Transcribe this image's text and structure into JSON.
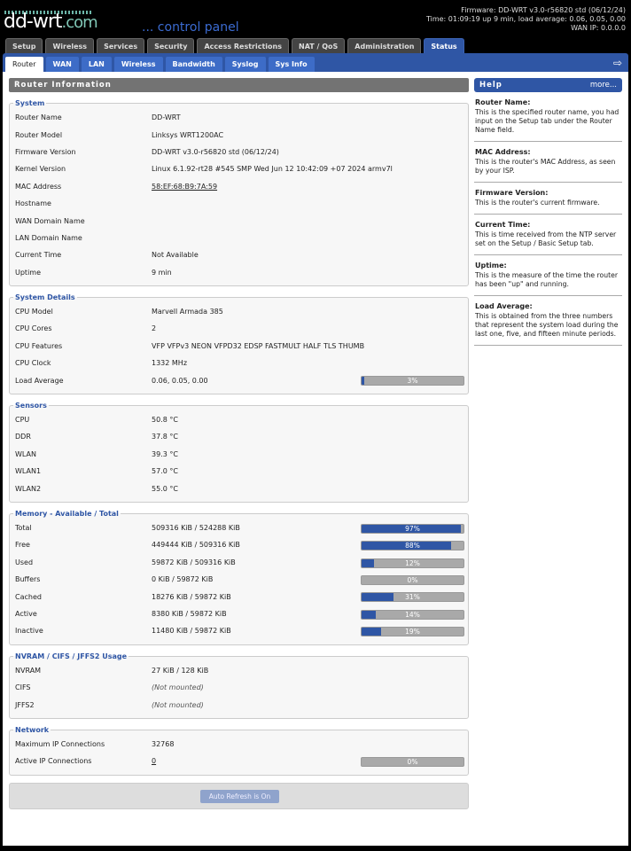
{
  "header": {
    "logo": "dd-wrt",
    "logo_com": ".com",
    "tagline": "... control panel",
    "firmware": "Firmware: DD-WRT v3.0-r56820 std (06/12/24)",
    "time": "Time: 01:09:19 up 9 min, load average: 0.06, 0.05, 0.00",
    "wan_ip": "WAN IP: 0.0.0.0"
  },
  "main_tabs": [
    "Setup",
    "Wireless",
    "Services",
    "Security",
    "Access Restrictions",
    "NAT / QoS",
    "Administration",
    "Status"
  ],
  "sub_tabs": [
    "Router",
    "WAN",
    "LAN",
    "Wireless",
    "Bandwidth",
    "Syslog",
    "Sys Info"
  ],
  "section_title": "Router Information",
  "system": {
    "legend": "System",
    "rows": [
      [
        "Router Name",
        "DD-WRT"
      ],
      [
        "Router Model",
        "Linksys WRT1200AC"
      ],
      [
        "Firmware Version",
        "DD-WRT v3.0-r56820 std (06/12/24)"
      ],
      [
        "Kernel Version",
        "Linux 6.1.92-rt28 #545 SMP Wed Jun 12 10:42:09 +07 2024 armv7l"
      ],
      [
        "MAC Address",
        "58:EF:68:B9:7A:59"
      ],
      [
        "Hostname",
        ""
      ],
      [
        "WAN Domain Name",
        ""
      ],
      [
        "LAN Domain Name",
        ""
      ],
      [
        "Current Time",
        "Not Available"
      ],
      [
        "Uptime",
        "9 min"
      ]
    ]
  },
  "details": {
    "legend": "System Details",
    "rows": [
      [
        "CPU Model",
        "Marvell Armada 385"
      ],
      [
        "CPU Cores",
        "2"
      ],
      [
        "CPU Features",
        "VFP VFPv3 NEON VFPD32 EDSP FASTMULT HALF TLS THUMB"
      ],
      [
        "CPU Clock",
        "1332 MHz"
      ],
      [
        "Load Average",
        "0.06, 0.05, 0.00"
      ]
    ],
    "load_pct": 3,
    "load_label": "3%"
  },
  "sensors": {
    "legend": "Sensors",
    "rows": [
      [
        "CPU",
        "50.8 °C"
      ],
      [
        "DDR",
        "37.8 °C"
      ],
      [
        "WLAN",
        "39.3 °C"
      ],
      [
        "WLAN1",
        "57.0 °C"
      ],
      [
        "WLAN2",
        "55.0 °C"
      ]
    ]
  },
  "memory": {
    "legend": "Memory - Available / Total",
    "rows": [
      {
        "label": "Total",
        "value": "509316 KiB / 524288 KiB",
        "pct": 97,
        "pct_label": "97%"
      },
      {
        "label": "Free",
        "value": "449444 KiB / 509316 KiB",
        "pct": 88,
        "pct_label": "88%"
      },
      {
        "label": "Used",
        "value": "59872 KiB / 509316 KiB",
        "pct": 12,
        "pct_label": "12%"
      },
      {
        "label": "Buffers",
        "value": "0 KiB / 59872 KiB",
        "pct": 0,
        "pct_label": "0%"
      },
      {
        "label": "Cached",
        "value": "18276 KiB / 59872 KiB",
        "pct": 31,
        "pct_label": "31%"
      },
      {
        "label": "Active",
        "value": "8380 KiB / 59872 KiB",
        "pct": 14,
        "pct_label": "14%"
      },
      {
        "label": "Inactive",
        "value": "11480 KiB / 59872 KiB",
        "pct": 19,
        "pct_label": "19%"
      }
    ]
  },
  "nvram": {
    "legend": "NVRAM / CIFS / JFFS2 Usage",
    "rows": [
      [
        "NVRAM",
        "27 KiB / 128 KiB"
      ],
      [
        "CIFS",
        "(Not mounted)"
      ],
      [
        "JFFS2",
        "(Not mounted)"
      ]
    ]
  },
  "network": {
    "legend": "Network",
    "rows": [
      [
        "Maximum IP Connections",
        "32768"
      ],
      [
        "Active IP Connections",
        "0"
      ]
    ],
    "conn_pct": 0,
    "conn_label": "0%"
  },
  "refresh_label": "Auto Refresh is On",
  "help": {
    "title": "Help",
    "more": "more...",
    "items": [
      {
        "title": "Router Name:",
        "text": "This is the specified router name, you had input on the Setup tab under the Router Name field."
      },
      {
        "title": "MAC Address:",
        "text": "This is the router's MAC Address, as seen by your ISP."
      },
      {
        "title": "Firmware Version:",
        "text": "This is the router's current firmware."
      },
      {
        "title": "Current Time:",
        "text": "This is time received from the NTP server set on the Setup / Basic Setup tab."
      },
      {
        "title": "Uptime:",
        "text": "This is the measure of the time the router has been \"up\" and running."
      },
      {
        "title": "Load Average:",
        "text": "This is obtained from the three numbers that represent the system load during the last one, five, and fifteen minute periods."
      }
    ]
  },
  "colors": {
    "accent": "#2f56a5",
    "bar_bg": "#a9a9a9"
  }
}
